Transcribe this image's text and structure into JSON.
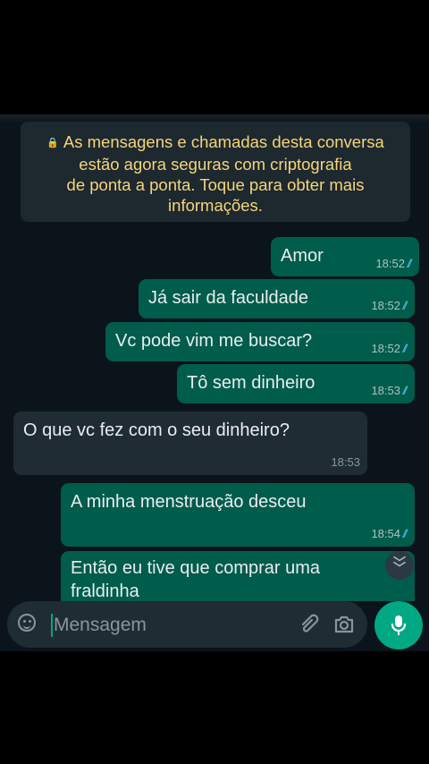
{
  "notice": {
    "lines": [
      "As mensagens e chamadas desta conversa",
      "estão agora seguras com criptografia",
      "de ponta a ponta. Toque para obter mais",
      "informações."
    ]
  },
  "messages": [
    {
      "text": "Amor",
      "time": "18:52",
      "dir": "out"
    },
    {
      "text": "Já sair da faculdade",
      "time": "18:52",
      "dir": "out"
    },
    {
      "text": "Vc pode vim me buscar?",
      "time": "18:52",
      "dir": "out"
    },
    {
      "text": "Tô sem dinheiro",
      "time": "18:53",
      "dir": "out"
    },
    {
      "text": "O que vc fez com o seu dinheiro?",
      "time": "18:53",
      "dir": "in"
    },
    {
      "text": "A minha menstruação desceu",
      "time": "18:54",
      "dir": "out"
    },
    {
      "text": "Então eu tive que comprar uma fraldinha",
      "time": "",
      "dir": "out"
    }
  ],
  "input": {
    "placeholder": "Mensagem"
  },
  "icons": {
    "emoji": "emoji-icon",
    "attach": "paperclip-icon",
    "camera": "camera-icon",
    "mic": "microphone-icon",
    "scroll": "double-chevron-down-icon",
    "lock": "lock-icon"
  },
  "colors": {
    "outgoing_bubble": "#005c4b",
    "incoming_bubble": "#1f2c34",
    "notice_text": "#f5d57a",
    "read_tick": "#53bdeb",
    "accent": "#00a884"
  }
}
